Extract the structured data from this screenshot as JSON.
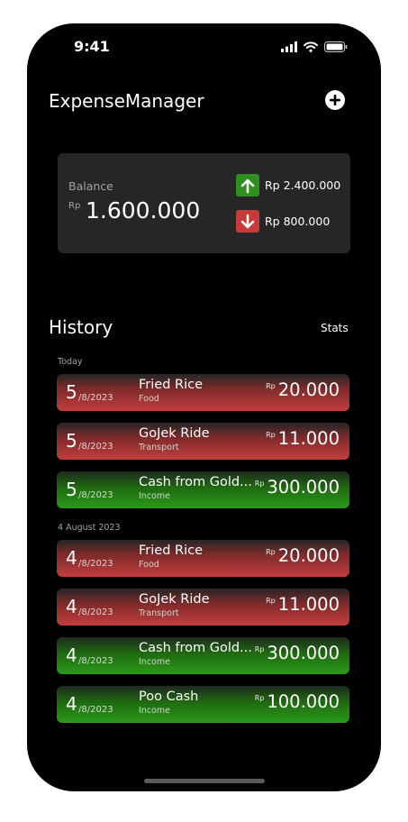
{
  "status": {
    "time": "9:41"
  },
  "header": {
    "title": "ExpenseManager"
  },
  "balance": {
    "label": "Balance",
    "currency": "Rp",
    "amount": "1.600.000",
    "income": "Rp 2.400.000",
    "expense": "Rp 800.000"
  },
  "history": {
    "title": "History",
    "stats_label": "Stats",
    "groups": [
      {
        "date": "Today",
        "items": [
          {
            "day": "5",
            "month": "/8/2023",
            "name": "Fried Rice",
            "category": "Food",
            "currency": "Rp",
            "amount": "20.000",
            "kind": "expense"
          },
          {
            "day": "5",
            "month": "/8/2023",
            "name": "GoJek Ride",
            "category": "Transport",
            "currency": "Rp",
            "amount": "11.000",
            "kind": "expense"
          },
          {
            "day": "5",
            "month": "/8/2023",
            "name": "Cash from Gold...",
            "category": "Income",
            "currency": "Rp",
            "amount": "300.000",
            "kind": "income"
          }
        ]
      },
      {
        "date": "4 August 2023",
        "items": [
          {
            "day": "4",
            "month": "/8/2023",
            "name": "Fried Rice",
            "category": "Food",
            "currency": "Rp",
            "amount": "20.000",
            "kind": "expense"
          },
          {
            "day": "4",
            "month": "/8/2023",
            "name": "GoJek Ride",
            "category": "Transport",
            "currency": "Rp",
            "amount": "11.000",
            "kind": "expense"
          },
          {
            "day": "4",
            "month": "/8/2023",
            "name": "Cash from Gold...",
            "category": "Income",
            "currency": "Rp",
            "amount": "300.000",
            "kind": "income"
          },
          {
            "day": "4",
            "month": "/8/2023",
            "name": "Poo Cash",
            "category": "Income",
            "currency": "Rp",
            "amount": "100.000",
            "kind": "income"
          }
        ]
      }
    ]
  },
  "icons": {
    "add": "plus-circle-icon",
    "income": "arrow-up-icon",
    "expense": "arrow-down-icon",
    "signal": "signal-icon",
    "wifi": "wifi-icon",
    "battery": "battery-icon"
  },
  "colors": {
    "background": "#000000",
    "card": "#262626",
    "income": "#2b9a1a",
    "expense": "#c23e3e"
  }
}
